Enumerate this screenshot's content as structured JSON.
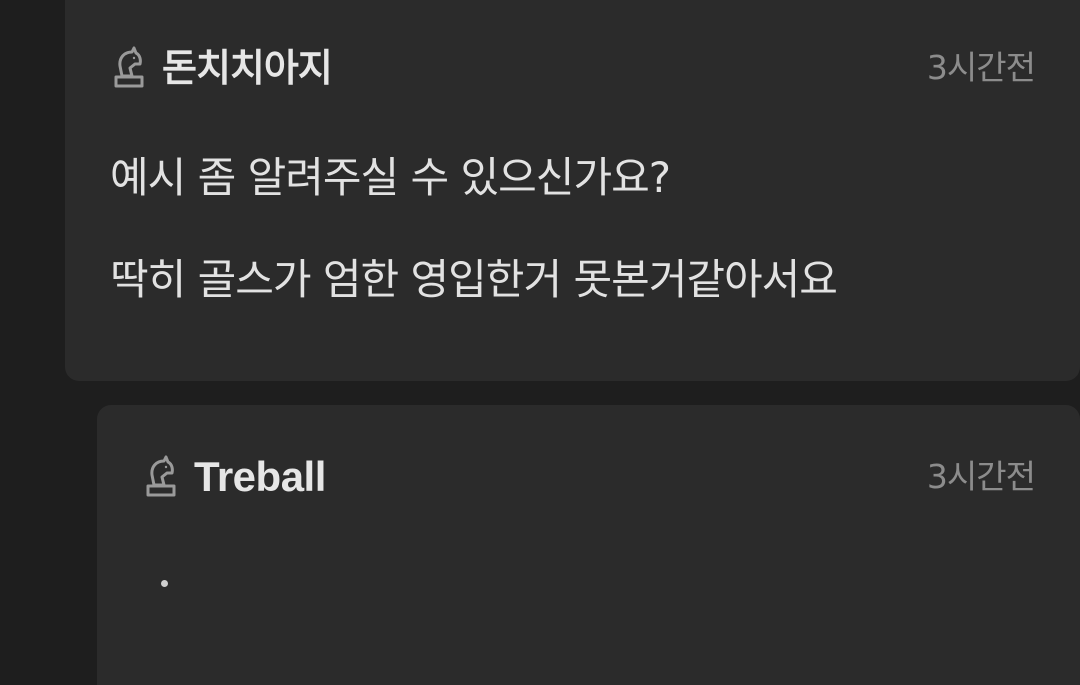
{
  "comments": {
    "main": {
      "username": "돈치치아지",
      "timestamp": "3시간전",
      "lines": [
        "예시 좀 알려주실 수 있으신가요?",
        "딱히 골스가 엄한 영입한거 못본거같아서요"
      ],
      "icon": "chess-knight-icon"
    },
    "reply": {
      "username": "Treball",
      "timestamp": "3시간전",
      "body": "·",
      "icon": "chess-knight-icon"
    }
  },
  "colors": {
    "background": "#1e1e1e",
    "card": "#2b2b2b",
    "text": "#e2e2e2",
    "muted": "#8c8c8c"
  }
}
